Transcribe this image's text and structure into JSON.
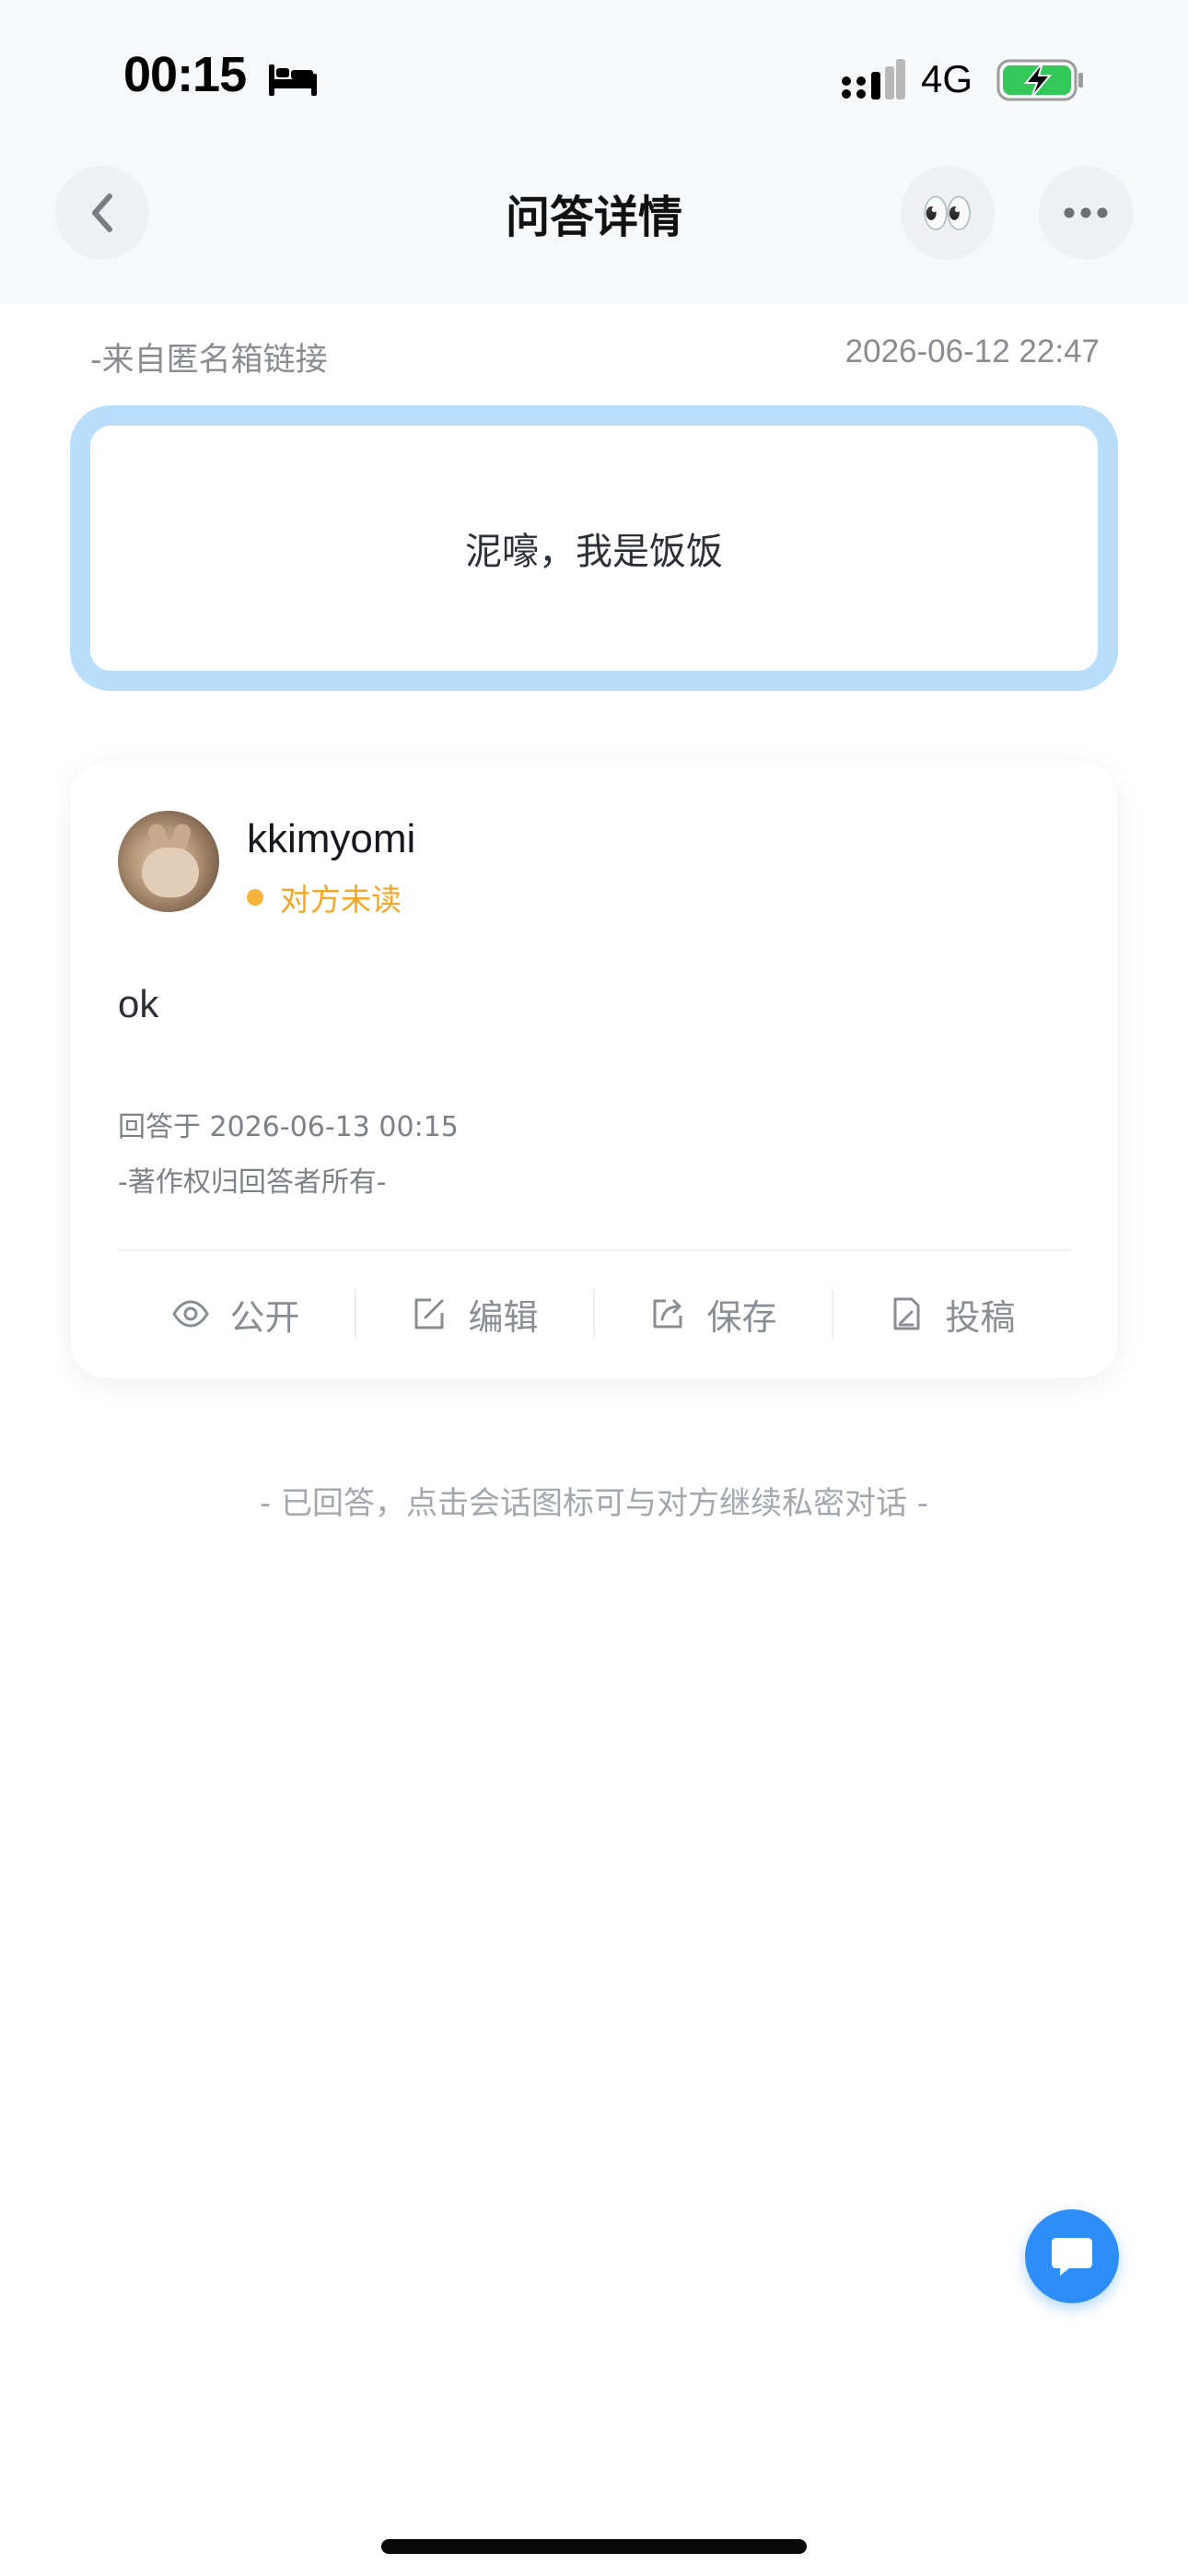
{
  "status_bar": {
    "time": "00:15",
    "network": "4G",
    "icons": [
      "bed-icon",
      "signal-icon",
      "battery-charging-icon"
    ]
  },
  "nav": {
    "title": "问答详情",
    "back_icon": "chevron-left-icon",
    "eyes_emoji": "👀",
    "more_icon": "more-dots-icon"
  },
  "question": {
    "source": "-来自匿名箱链接",
    "time": "2026-06-12 22:47",
    "text": "泥嚎，我是饭饭",
    "border_color": "#b9defb"
  },
  "answer": {
    "username": "kkimyomi",
    "read_status": "对方未读",
    "status_color": "#f5a623",
    "text": "ok",
    "answered_at": "回答于 2026-06-13 00:15",
    "copyright": "-著作权归回答者所有-",
    "actions": [
      {
        "label": "公开",
        "icon": "eye-icon"
      },
      {
        "label": "编辑",
        "icon": "edit-icon"
      },
      {
        "label": "保存",
        "icon": "share-icon"
      },
      {
        "label": "投稿",
        "icon": "submit-icon"
      }
    ]
  },
  "hint": "- 已回答，点击会话图标可与对方继续私密对话 -",
  "fab": {
    "icon": "chat-bubble-icon",
    "color": "#2e8ef7"
  }
}
